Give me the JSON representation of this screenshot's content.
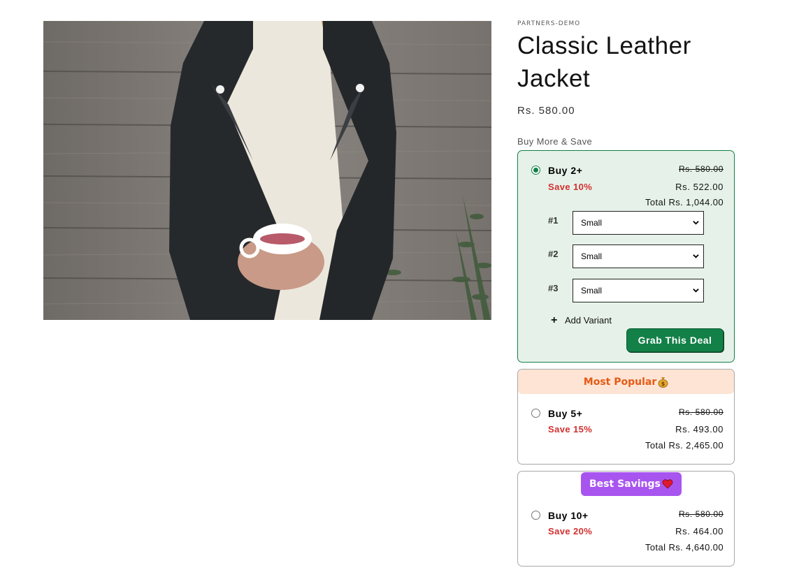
{
  "product": {
    "vendor": "PARTNERS-DEMO",
    "title": "Classic Leather Jacket",
    "price": "Rs. 580.00",
    "image_alt": "Woman in black leather jacket holding a tea cup"
  },
  "bundle": {
    "label": "Buy More & Save",
    "offers": [
      {
        "quantity_label": "Buy 2+",
        "save_label": "Save 10%",
        "original_price": "Rs. 580.00",
        "discounted_price": "Rs. 522.00",
        "total": "Total Rs. 1,044.00",
        "selected": true,
        "variants": [
          {
            "label": "#1",
            "value": "Small"
          },
          {
            "label": "#2",
            "value": "Small"
          },
          {
            "label": "#3",
            "value": "Small"
          }
        ],
        "add_variant_label": "Add Variant",
        "cta_label": "Grab This Deal"
      },
      {
        "banner": "Most Popular",
        "banner_emoji": "money-bag-icon",
        "quantity_label": "Buy 5+",
        "save_label": "Save 15%",
        "original_price": "Rs. 580.00",
        "discounted_price": "Rs. 493.00",
        "total": "Total Rs. 2,465.00",
        "selected": false
      },
      {
        "banner": "Best Savings",
        "banner_emoji": "heart-icon",
        "quantity_label": "Buy 10+",
        "save_label": "Save 20%",
        "original_price": "Rs. 580.00",
        "discounted_price": "Rs. 464.00",
        "total": "Total Rs. 4,640.00",
        "selected": false
      }
    ]
  },
  "colors": {
    "accent_green": "#138048",
    "save_red": "#d32f2f",
    "popular_bg": "#fde4d4",
    "popular_text": "#e65a16",
    "best_bg": "#a855f0"
  }
}
